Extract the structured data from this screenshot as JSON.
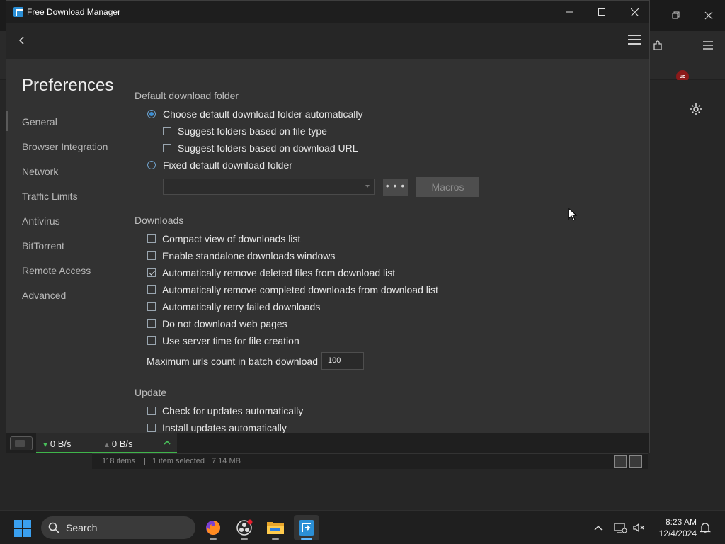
{
  "window": {
    "title": "Free Download Manager"
  },
  "preferences": {
    "title": "Preferences",
    "nav": [
      {
        "label": "General"
      },
      {
        "label": "Browser Integration"
      },
      {
        "label": "Network"
      },
      {
        "label": "Traffic Limits"
      },
      {
        "label": "Antivirus"
      },
      {
        "label": "BitTorrent"
      },
      {
        "label": "Remote Access"
      },
      {
        "label": "Advanced"
      }
    ],
    "default_folder": {
      "section_title": "Default download folder",
      "auto_label": "Choose default download folder automatically",
      "auto_checked": true,
      "suggest_type_label": "Suggest folders based on file type",
      "suggest_type_checked": false,
      "suggest_url_label": "Suggest folders based on download URL",
      "suggest_url_checked": false,
      "fixed_label": "Fixed default download folder",
      "fixed_checked": false,
      "folder_value": "",
      "browse_label": "• • •",
      "macros_label": "Macros"
    },
    "downloads": {
      "section_title": "Downloads",
      "options": [
        {
          "label": "Compact view of downloads list",
          "checked": false
        },
        {
          "label": "Enable standalone downloads windows",
          "checked": false
        },
        {
          "label": "Automatically remove deleted files from download list",
          "checked": true
        },
        {
          "label": "Automatically remove completed downloads from download list",
          "checked": false
        },
        {
          "label": "Automatically retry failed downloads",
          "checked": false
        },
        {
          "label": "Do not download web pages",
          "checked": false
        },
        {
          "label": "Use server time for file creation",
          "checked": false
        }
      ],
      "max_urls_label": "Maximum urls count in batch download",
      "max_urls_value": "100"
    },
    "update": {
      "section_title": "Update",
      "options": [
        {
          "label": "Check for updates automatically",
          "checked": false
        },
        {
          "label": "Install updates automatically",
          "checked": false
        }
      ]
    }
  },
  "statusbar": {
    "download_speed": "0 B/s",
    "upload_speed": "0 B/s"
  },
  "background_window": {
    "items_count": "118 items",
    "selected": "1 item selected",
    "selected_size": "7.14 MB",
    "extension_badge": "uo"
  },
  "taskbar": {
    "search_label": "Search",
    "time": "8:23 AM",
    "date": "12/4/2024"
  },
  "colors": {
    "accent_blue": "#3d8fd4",
    "speed_green": "#3fb54a",
    "window_bg": "#323232"
  }
}
